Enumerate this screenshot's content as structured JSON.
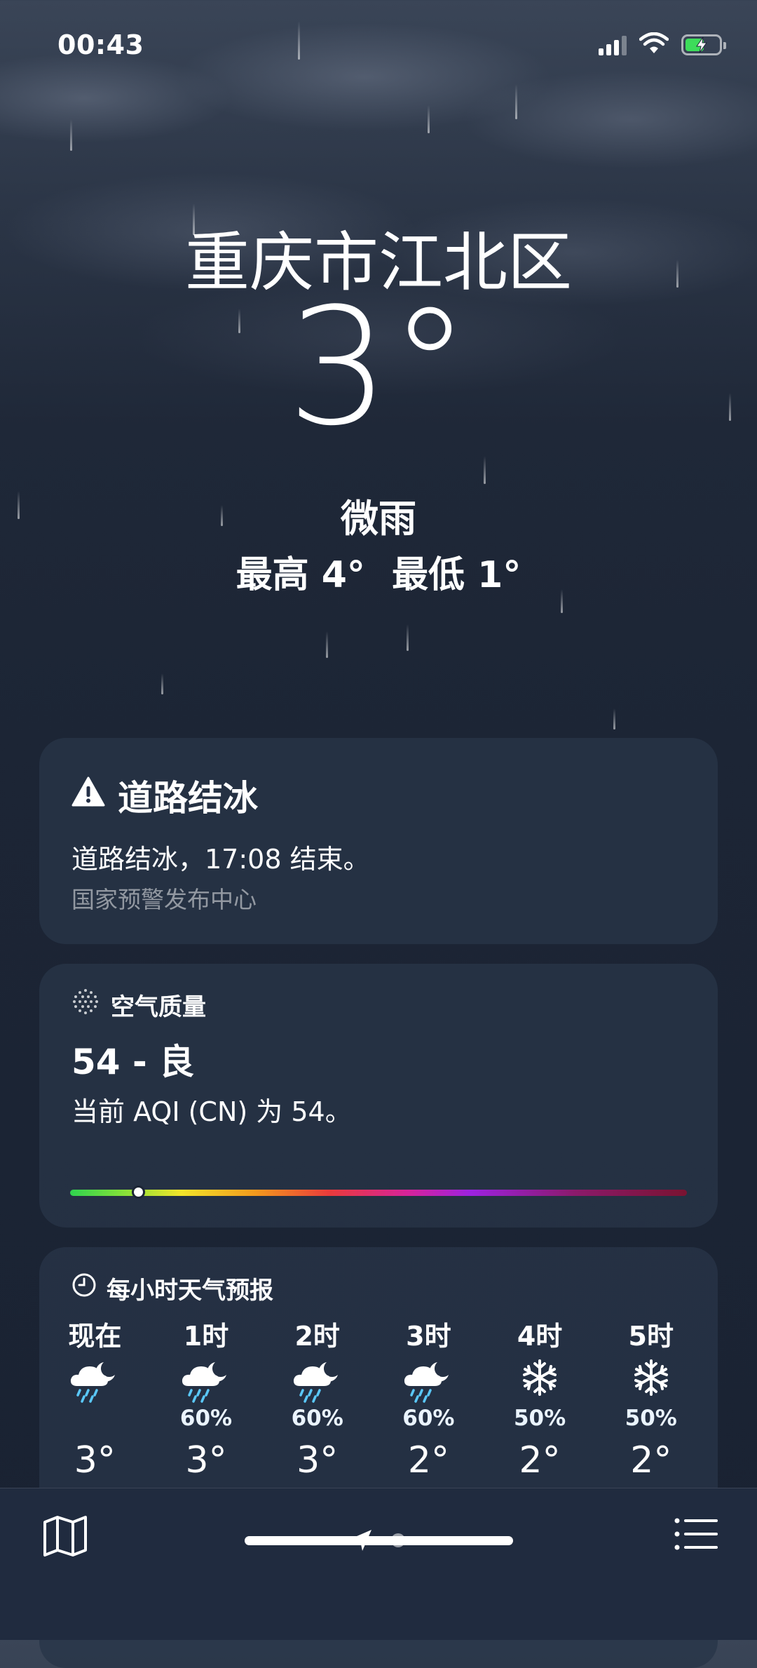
{
  "status_bar": {
    "time": "00:43"
  },
  "location": {
    "city": "重庆市江北区",
    "temperature": "3°",
    "condition": "微雨",
    "high": "最高 4°",
    "low": "最低 1°"
  },
  "alert_card": {
    "title": "道路结冰",
    "text": "道路结冰，17:08 结束。",
    "source": "国家预警发布中心"
  },
  "aqi_card": {
    "header": "空气质量",
    "value": "54 - 良",
    "description": "当前 AQI (CN) 为 54。",
    "level_fraction": 0.11
  },
  "hourly_card": {
    "header": "每小时天气预报",
    "hours": [
      {
        "label": "现在",
        "icon": "cloud-moon-rain-icon",
        "pct": "",
        "temp": "3°"
      },
      {
        "label": "1时",
        "icon": "cloud-moon-rain-icon",
        "pct": "60%",
        "temp": "3°"
      },
      {
        "label": "2时",
        "icon": "cloud-moon-rain-icon",
        "pct": "60%",
        "temp": "3°"
      },
      {
        "label": "3时",
        "icon": "cloud-moon-rain-icon",
        "pct": "60%",
        "temp": "2°"
      },
      {
        "label": "4时",
        "icon": "snowflake-icon",
        "pct": "50%",
        "temp": "2°"
      },
      {
        "label": "5时",
        "icon": "snowflake-icon",
        "pct": "50%",
        "temp": "2°"
      }
    ]
  },
  "colors": {
    "rain_accent": "#5ac8fa",
    "battery_green": "#3ddc5a",
    "card_bg": "#283448"
  }
}
